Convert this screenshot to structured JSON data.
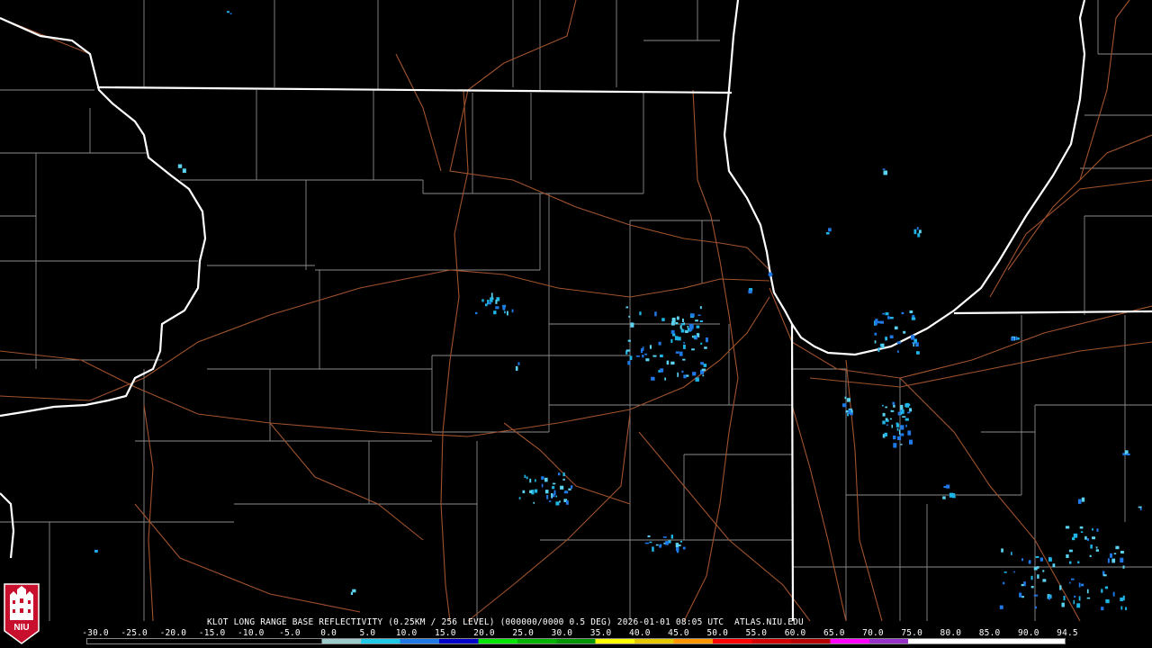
{
  "product": {
    "title": "KLOT LONG RANGE BASE REFLECTIVITY (0.25KM / 256 LEVEL) (000000/0000 0.5 DEG) 2026-01-01 08:05 UTC  ATLAS.NIU.EDU"
  },
  "logo": {
    "text": "NIU",
    "color": "#c8102e"
  },
  "scale": {
    "labels": [
      "-30.0",
      "-25.0",
      "-20.0",
      "-15.0",
      "-10.0",
      "-5.0",
      "0.0",
      "5.0",
      "10.0",
      "15.0",
      "20.0",
      "25.0",
      "30.0",
      "35.0",
      "40.0",
      "45.0",
      "50.0",
      "55.0",
      "60.0",
      "65.0",
      "70.0",
      "75.0",
      "80.0",
      "85.0",
      "90.0",
      "94.5"
    ],
    "colors": [
      "#000000",
      "#000000",
      "#000000",
      "#000000",
      "#000000",
      "#000000",
      "#9ccaca",
      "#1ec8e6",
      "#1e78e6",
      "#0000c8",
      "#00e600",
      "#00b400",
      "#009600",
      "#ffff00",
      "#e6c800",
      "#ff9600",
      "#ff0000",
      "#d20000",
      "#b40000",
      "#ff00ff",
      "#9632c8",
      "#ffffff",
      "#ffffff",
      "#ffffff",
      "#ffffff"
    ]
  },
  "map_colors": {
    "state_lines": "#ffffff",
    "county_lines": "#8c8c8c",
    "roads": "#a0522d",
    "echo_light": "#5ad2f0",
    "echo_mid": "#1eb4e6",
    "echo_dark": "#1e78e6"
  }
}
